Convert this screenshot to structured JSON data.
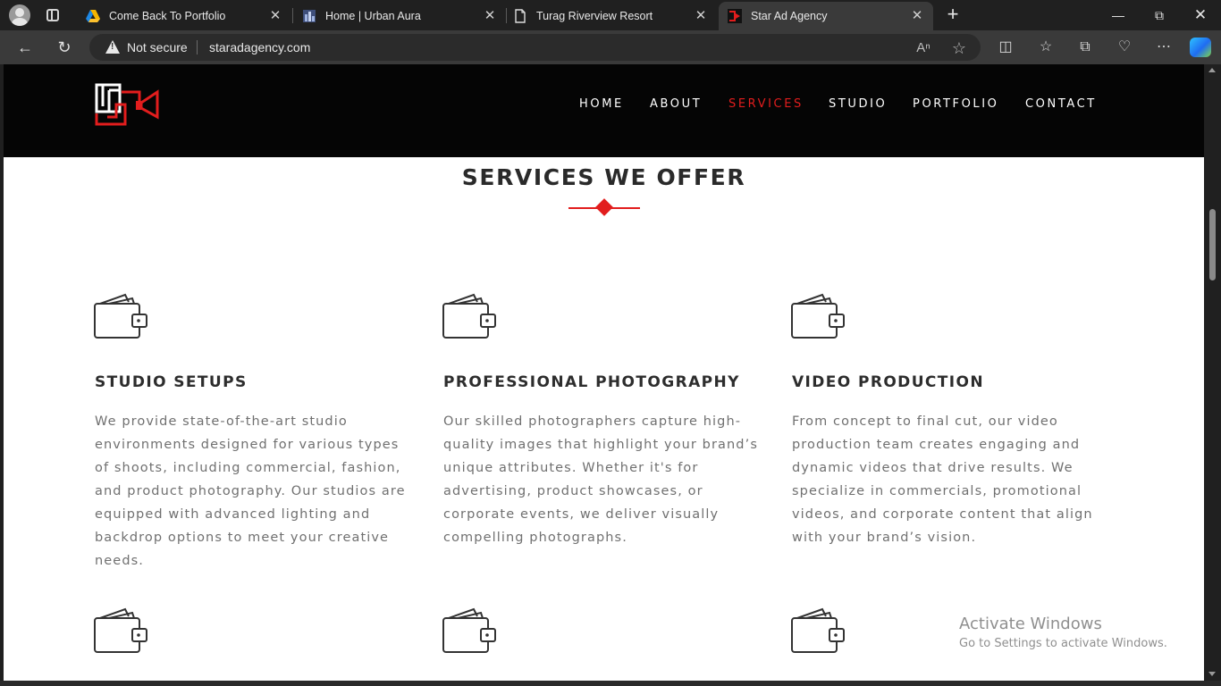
{
  "browser": {
    "tabs": [
      {
        "title": "Come Back To Portfolio",
        "icon": "drive-icon"
      },
      {
        "title": "Home | Urban Aura",
        "icon": "site-icon"
      },
      {
        "title": "Turag Riverview Resort",
        "icon": "page-icon"
      },
      {
        "title": "Star Ad Agency",
        "icon": "star-ad-icon",
        "active": true
      }
    ],
    "security_label": "Not secure",
    "url": "staradagency.com"
  },
  "site": {
    "nav": [
      "HOME",
      "ABOUT",
      "SERVICES",
      "STUDIO",
      "PORTFOLIO",
      "CONTACT"
    ],
    "active_nav": "SERVICES",
    "accent_color": "#e21d1d"
  },
  "services": {
    "heading": "SERVICES WE OFFER",
    "cards": [
      {
        "title": "STUDIO SETUPS",
        "text": "We provide state-of-the-art studio environments designed for various types of shoots, including commercial, fashion, and product photography. Our studios are equipped with advanced lighting and backdrop options to meet your creative needs.",
        "icon": "wallet-icon"
      },
      {
        "title": "PROFESSIONAL PHOTOGRAPHY",
        "text": "Our skilled photographers capture high-quality images that highlight your brand’s unique attributes. Whether it's for advertising, product showcases, or corporate events, we deliver visually compelling photographs.",
        "icon": "wallet-icon"
      },
      {
        "title": "VIDEO PRODUCTION",
        "text": "From concept to final cut, our video production team creates engaging and dynamic videos that drive results. We specialize in commercials, promotional videos, and corporate content that align with your brand’s vision.",
        "icon": "wallet-icon"
      }
    ]
  },
  "watermark": {
    "line1": "Activate Windows",
    "line2": "Go to Settings to activate Windows."
  }
}
